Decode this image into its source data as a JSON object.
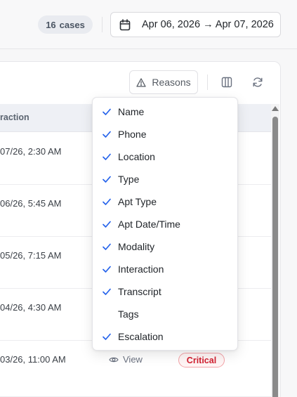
{
  "header": {
    "cases_count": "16",
    "cases_label": "cases",
    "date_range": "Apr 06, 2026 → Apr 07, 2026"
  },
  "toolbar": {
    "reasons_label": "Reasons"
  },
  "table": {
    "column_header": "raction",
    "rows": [
      {
        "date": "07/26, 2:30 AM"
      },
      {
        "date": "06/26, 5:45 AM"
      },
      {
        "date": "05/26, 7:15 AM"
      },
      {
        "date": "04/26, 4:30 AM"
      },
      {
        "date": "03/26, 11:00 AM",
        "view_label": "View",
        "badge": "Critical"
      }
    ]
  },
  "column_menu": {
    "items": [
      {
        "label": "Name",
        "checked": true
      },
      {
        "label": "Phone",
        "checked": true
      },
      {
        "label": "Location",
        "checked": true
      },
      {
        "label": "Type",
        "checked": true
      },
      {
        "label": "Apt Type",
        "checked": true
      },
      {
        "label": "Apt Date/Time",
        "checked": true
      },
      {
        "label": "Modality",
        "checked": true
      },
      {
        "label": "Interaction",
        "checked": true
      },
      {
        "label": "Transcript",
        "checked": true
      },
      {
        "label": "Tags",
        "checked": false
      },
      {
        "label": "Escalation",
        "checked": true
      }
    ]
  },
  "colors": {
    "accent": "#2563eb",
    "critical": "#d11f2f"
  },
  "icons": {
    "calendar": "calendar-icon",
    "reasons": "alert-triangle-icon",
    "columns": "columns-icon",
    "refresh": "refresh-icon",
    "check": "check-icon",
    "eye": "eye-icon"
  }
}
